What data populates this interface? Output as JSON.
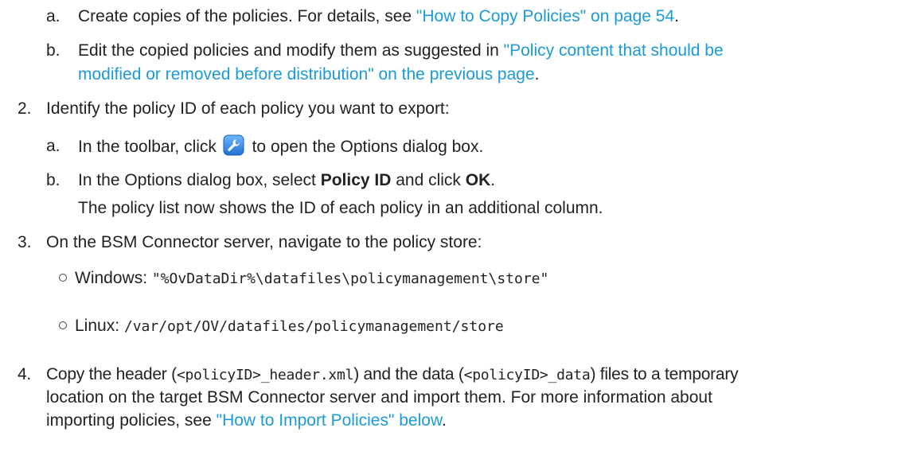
{
  "step1": {
    "a": {
      "marker": "a.",
      "text_before": "Create copies of the policies. For details, see ",
      "link": "\"How to Copy Policies\" on page 54",
      "text_after": "."
    },
    "b": {
      "marker": "b.",
      "text_before": "Edit the copied policies and modify them as suggested in ",
      "link_line1": "\"Policy content that should be",
      "link_line2": "modified or removed before distribution\" on the previous page",
      "text_after": "."
    }
  },
  "step2": {
    "marker": "2.",
    "text": "Identify the policy ID of each policy you want to export:",
    "a": {
      "marker": "a.",
      "text_before": "In the toolbar, click ",
      "icon": "options-wrench-icon",
      "text_after": " to open the Options dialog box."
    },
    "b": {
      "marker": "b.",
      "text_before": "In the Options dialog box, select ",
      "bold1": "Policy ID",
      "text_mid": " and click ",
      "bold2": "OK",
      "text_after": "."
    },
    "note": "The policy list now shows the ID of each policy in an additional column."
  },
  "step3": {
    "marker": "3.",
    "text": "On the BSM Connector server, navigate to the policy store:",
    "windows_label": "Windows: ",
    "windows_path": "\"%OvDataDir%\\datafiles\\policymanagement\\store\"",
    "linux_label": "Linux: ",
    "linux_path": "/var/opt/OV/datafiles/policymanagement/store"
  },
  "step4": {
    "marker": "4.",
    "t1": "Copy the header (",
    "code1": "<policyID>_header.xml",
    "t2": ") and the data (",
    "code2": "<policyID>_data",
    "t3": ") files to a temporary",
    "line2": "location on the target BSM Connector server and import them. For more information about",
    "line3_before": "importing policies, see ",
    "line3_link": "\"How to Import Policies\" below",
    "line3_after": "."
  },
  "colors": {
    "link": "#1a9bd7",
    "text": "#222222",
    "icon_blue": "#2a84e0"
  }
}
